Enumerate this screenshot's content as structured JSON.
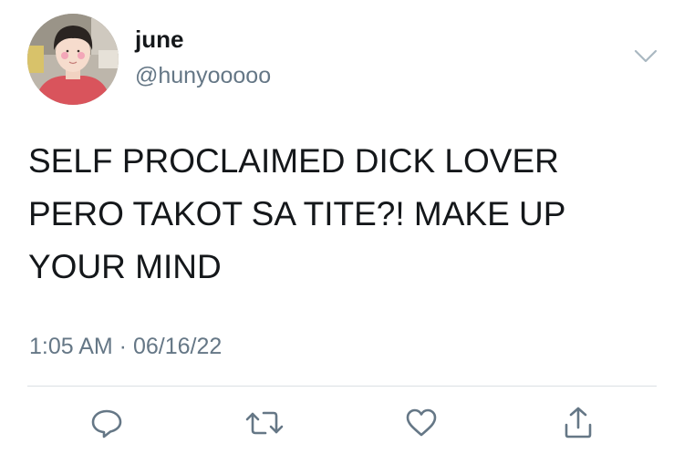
{
  "user": {
    "display_name": "june",
    "handle": "@hunyooooo",
    "avatar_icon": "profile-photo"
  },
  "tweet": {
    "text": "SELF PROCLAIMED DICK LOVER\nPERO TAKOT SA TITE?! MAKE UP\nYOUR MIND",
    "timestamp": "1:05 AM · 06/16/22"
  },
  "actions": {
    "reply_icon": "reply-icon",
    "retweet_icon": "retweet-icon",
    "like_icon": "like-icon",
    "share_icon": "share-icon",
    "menu_icon": "chevron-down-icon"
  },
  "colors": {
    "text": "#14171a",
    "secondary": "#657786",
    "divider": "#dbe0e4"
  }
}
